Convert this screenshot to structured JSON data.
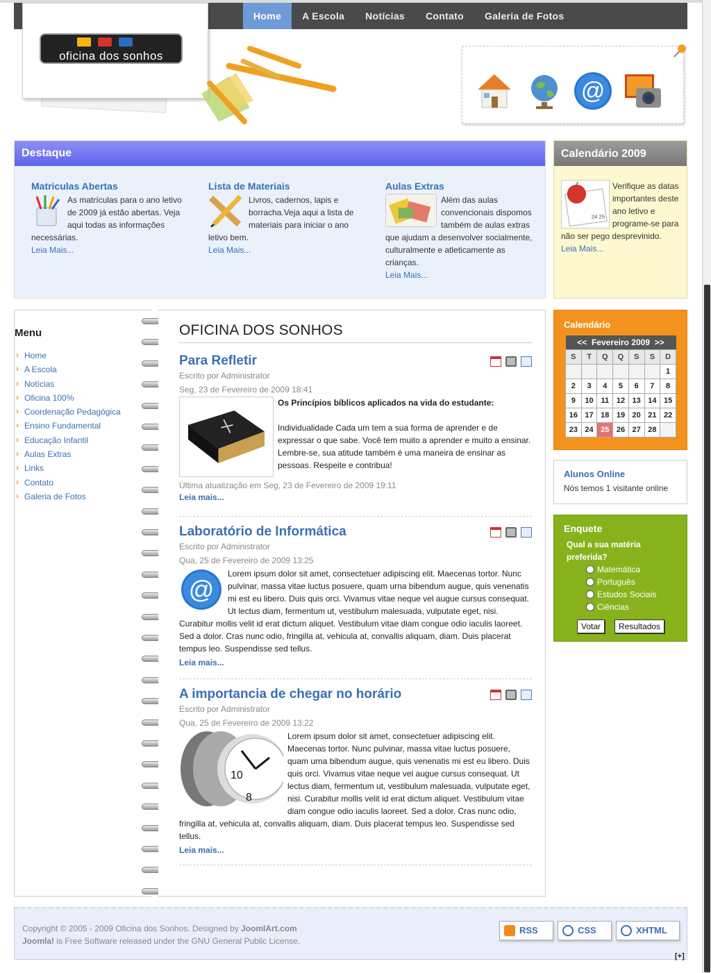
{
  "nav": {
    "items": [
      "Home",
      "A Escola",
      "Notícias",
      "Contato",
      "Galeria de Fotos"
    ],
    "active": 0
  },
  "header": {
    "logo_text": "oficina dos sonhos",
    "icons": [
      "house-icon",
      "globe-icon",
      "at-sign-icon",
      "photo-camera-icon"
    ]
  },
  "destaque": {
    "title": "Destaque",
    "columns": [
      {
        "title": "Matriculas Abertas",
        "text": "As matrículas para o ano letivo de 2009 já estão abertas. Veja aqui todas as informações necessárias.",
        "more": "Leia Mais..."
      },
      {
        "title": "Lista de Materiais",
        "text": "Livros, cadernos, lapis e borracha.Veja aqui a lista de materiais para iniciar o ano letivo bem.",
        "more": "Leia Mais..."
      },
      {
        "title": "Aulas Extras",
        "text": "Além das aulas convencionais dispomos também de aulas extras que ajudam a desenvolver socialmente, culturalmente e atleticamente as crianças.",
        "more": "Leia Mais..."
      }
    ]
  },
  "calendario_box": {
    "title": "Calendário 2009",
    "text": "Verifique as datas importantes deste ano letivo e programe-se para não ser pego desprevinido.",
    "more": "Leia Mais..."
  },
  "menu": {
    "title": "Menu",
    "items": [
      "Home",
      "A Escola",
      "Notícias",
      "Oficina 100%",
      "Coordenação Pedagógica",
      "Ensino Fundamental",
      "Educação Infantil",
      "Aulas Extras",
      "Links",
      "Contato",
      "Galeria de Fotos"
    ]
  },
  "main": {
    "title": "OFICINA DOS SONHOS",
    "articles": [
      {
        "title": "Para Refletir",
        "author": "Escrito por Administrator",
        "date": "Seg, 23 de Fevereiro de 2009 18:41",
        "lead": "Os Princípios bíblicos aplicados na vida do estudante:",
        "text": "Individualidade Cada um tem a sua forma de aprender e de expressar o que sabe. Você tem muito a aprender e muito a ensinar. Lembre-se, sua atitude também é uma maneira de ensinar as pessoas. Respeite e contribua!",
        "updated": "Última atualização em Seg, 23 de Fevereiro de 2009 19:11",
        "more": "Leia mais..."
      },
      {
        "title": "Laboratório de Informática",
        "author": "Escrito por Administrator",
        "date": "Qua, 25 de Fevereiro de 2009 13:25",
        "text": "Lorem ipsum dolor sit amet, consectetuer adipiscing elit. Maecenas tortor. Nunc pulvinar, massa vitae luctus posuere, quam urna bibendum augue, quis venenatis mi est eu libero. Duis quis orci. Vivamus vitae neque vel augue cursus consequat. Ut lectus diam, fermentum ut, vestibulum malesuada, vulputate eget, nisi. Curabitur mollis velit id erat dictum aliquet. Vestibulum vitae diam congue odio iaculis laoreet. Sed a dolor. Cras nunc odio, fringilla at, vehicula at, convallis aliquam, diam. Duis placerat tempus leo. Suspendisse sed tellus.",
        "more": "Leia mais..."
      },
      {
        "title": "A importancia de chegar no horário",
        "author": "Escrito por Administrator",
        "date": "Qua, 25 de Fevereiro de 2009 13:22",
        "text": "Lorem ipsum dolor sit amet, consectetuer adipiscing elit. Maecenas tortor. Nunc pulvinar, massa vitae luctus posuere, quam urna bibendum augue, quis venenatis mi est eu libero. Duis quis orci. Vivamus vitae neque vel augue cursus consequat. Ut lectus diam, fermentum ut, vestibulum malesuada, vulputate eget, nisi. Curabitur mollis velit id erat dictum aliquet. Vestibulum vitae diam congue odio iaculis laoreet. Sed a dolor. Cras nunc odio, fringilla at, vehicula at, convallis aliquam, diam. Duis placerat tempus leo. Suspendisse sed tellus.",
        "more": "Leia mais..."
      }
    ]
  },
  "calendar": {
    "title": "Calendário",
    "prev": "<<",
    "month": "Fevereiro 2009",
    "next": ">>",
    "days": [
      "S",
      "T",
      "Q",
      "Q",
      "S",
      "S",
      "D"
    ],
    "weeks": [
      [
        "",
        "",
        "",
        "",
        "",
        "",
        "1"
      ],
      [
        "2",
        "3",
        "4",
        "5",
        "6",
        "7",
        "8"
      ],
      [
        "9",
        "10",
        "11",
        "12",
        "13",
        "14",
        "15"
      ],
      [
        "16",
        "17",
        "18",
        "19",
        "20",
        "21",
        "22"
      ],
      [
        "23",
        "24",
        "25",
        "26",
        "27",
        "28",
        ""
      ]
    ],
    "today": "25"
  },
  "online": {
    "title": "Alunos Online",
    "text": "Nós temos 1 visitante online"
  },
  "poll": {
    "title": "Enquete",
    "question": "Qual a sua matéria preferida?",
    "options": [
      "Matemática",
      "Português",
      "Estudos Sociais",
      "Ciências"
    ],
    "vote": "Votar",
    "results": "Resultados"
  },
  "footer": {
    "copyright": "Copyright © 2005 - 2009 Oficina dos Sonhos. Designed by",
    "designer": "JoomlArt.com",
    "joomla": "Joomla!",
    "license": "is Free Software released under the GNU General Public License.",
    "badges": [
      "RSS",
      "CSS",
      "XHTML"
    ],
    "toggle": "[+]"
  },
  "colors": {
    "accent": "#3a6fb3",
    "nav_active": "#6e9ad8",
    "destaque_head": "#6063f0",
    "orange": "#f4921e",
    "green": "#88b21c",
    "today": "#e27470"
  }
}
